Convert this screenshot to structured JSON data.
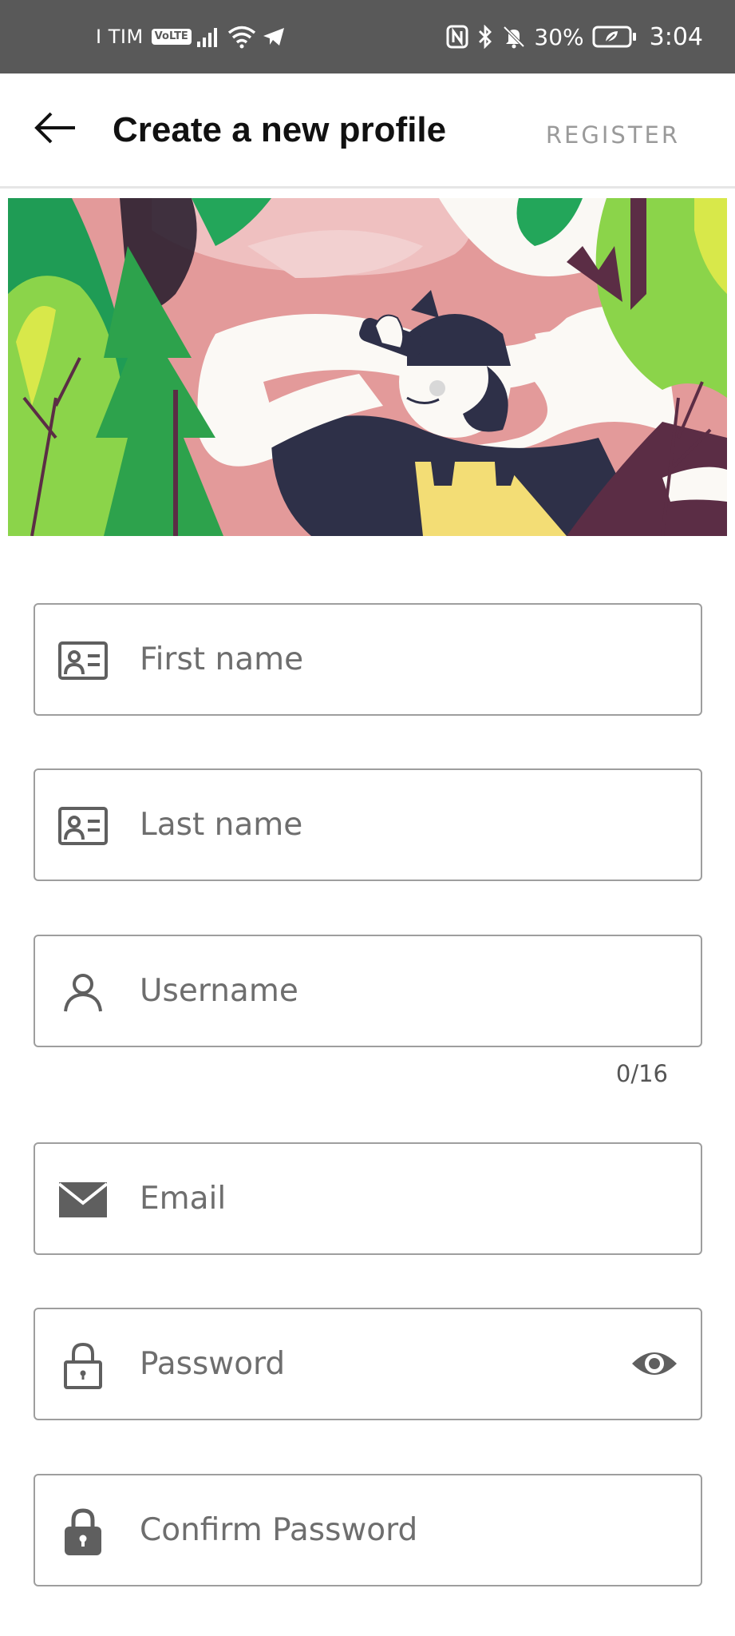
{
  "status_bar": {
    "carrier": "I TIM",
    "volte": "VoLTE",
    "battery_percent": "30%",
    "time": "3:04",
    "icons": [
      "signal-icon",
      "wifi-icon",
      "telegram-icon",
      "nfc-icon",
      "bluetooth-icon",
      "bell-muted-icon",
      "battery-icon"
    ]
  },
  "app_bar": {
    "back_icon": "arrow-left-icon",
    "title": "Create a new profile",
    "register_label": "REGISTER"
  },
  "hero": {
    "description_icon": "hiker-illustration"
  },
  "form": {
    "first_name": {
      "placeholder": "First name",
      "icon": "id-card-icon"
    },
    "last_name": {
      "placeholder": "Last name",
      "icon": "id-card-icon"
    },
    "username": {
      "placeholder": "Username",
      "icon": "person-icon",
      "counter": "0/16"
    },
    "email": {
      "placeholder": "Email",
      "icon": "envelope-icon"
    },
    "password": {
      "placeholder": "Password",
      "icon": "lock-outline-icon",
      "toggle_icon": "eye-icon"
    },
    "confirm_password": {
      "placeholder": "Confirm Password",
      "icon": "lock-filled-icon"
    }
  },
  "colors": {
    "status_bar_bg": "#595959",
    "field_border": "#9e9e9e",
    "placeholder": "#6e6e6e",
    "register_text": "#9a9a9a"
  }
}
